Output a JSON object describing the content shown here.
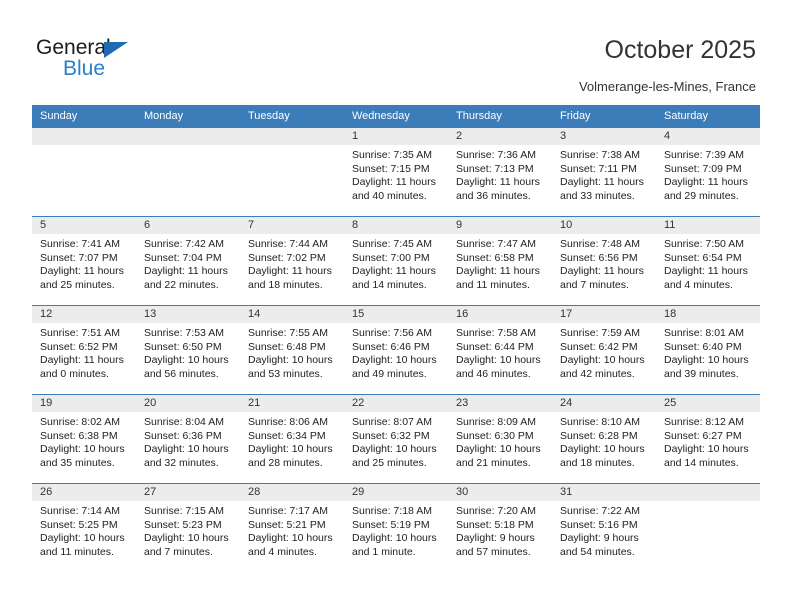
{
  "brand": {
    "word1": "General",
    "word2": "Blue",
    "triangle_color": "#1f6cb4",
    "blue_color": "#2a7fc9"
  },
  "header": {
    "title": "October 2025",
    "location": "Volmerange-les-Mines, France"
  },
  "theme": {
    "header_bg": "#3b7cb9",
    "daynum_bg": "#ececec",
    "text": "#1f1f1f"
  },
  "weekdays": [
    "Sunday",
    "Monday",
    "Tuesday",
    "Wednesday",
    "Thursday",
    "Friday",
    "Saturday"
  ],
  "weeks": [
    [
      {
        "day": "",
        "empty": true
      },
      {
        "day": "",
        "empty": true
      },
      {
        "day": "",
        "empty": true
      },
      {
        "day": "1",
        "sunrise": "Sunrise: 7:35 AM",
        "sunset": "Sunset: 7:15 PM",
        "daylight1": "Daylight: 11 hours",
        "daylight2": "and 40 minutes."
      },
      {
        "day": "2",
        "sunrise": "Sunrise: 7:36 AM",
        "sunset": "Sunset: 7:13 PM",
        "daylight1": "Daylight: 11 hours",
        "daylight2": "and 36 minutes."
      },
      {
        "day": "3",
        "sunrise": "Sunrise: 7:38 AM",
        "sunset": "Sunset: 7:11 PM",
        "daylight1": "Daylight: 11 hours",
        "daylight2": "and 33 minutes."
      },
      {
        "day": "4",
        "sunrise": "Sunrise: 7:39 AM",
        "sunset": "Sunset: 7:09 PM",
        "daylight1": "Daylight: 11 hours",
        "daylight2": "and 29 minutes."
      }
    ],
    [
      {
        "day": "5",
        "sunrise": "Sunrise: 7:41 AM",
        "sunset": "Sunset: 7:07 PM",
        "daylight1": "Daylight: 11 hours",
        "daylight2": "and 25 minutes."
      },
      {
        "day": "6",
        "sunrise": "Sunrise: 7:42 AM",
        "sunset": "Sunset: 7:04 PM",
        "daylight1": "Daylight: 11 hours",
        "daylight2": "and 22 minutes."
      },
      {
        "day": "7",
        "sunrise": "Sunrise: 7:44 AM",
        "sunset": "Sunset: 7:02 PM",
        "daylight1": "Daylight: 11 hours",
        "daylight2": "and 18 minutes."
      },
      {
        "day": "8",
        "sunrise": "Sunrise: 7:45 AM",
        "sunset": "Sunset: 7:00 PM",
        "daylight1": "Daylight: 11 hours",
        "daylight2": "and 14 minutes."
      },
      {
        "day": "9",
        "sunrise": "Sunrise: 7:47 AM",
        "sunset": "Sunset: 6:58 PM",
        "daylight1": "Daylight: 11 hours",
        "daylight2": "and 11 minutes."
      },
      {
        "day": "10",
        "sunrise": "Sunrise: 7:48 AM",
        "sunset": "Sunset: 6:56 PM",
        "daylight1": "Daylight: 11 hours",
        "daylight2": "and 7 minutes."
      },
      {
        "day": "11",
        "sunrise": "Sunrise: 7:50 AM",
        "sunset": "Sunset: 6:54 PM",
        "daylight1": "Daylight: 11 hours",
        "daylight2": "and 4 minutes."
      }
    ],
    [
      {
        "day": "12",
        "sunrise": "Sunrise: 7:51 AM",
        "sunset": "Sunset: 6:52 PM",
        "daylight1": "Daylight: 11 hours",
        "daylight2": "and 0 minutes."
      },
      {
        "day": "13",
        "sunrise": "Sunrise: 7:53 AM",
        "sunset": "Sunset: 6:50 PM",
        "daylight1": "Daylight: 10 hours",
        "daylight2": "and 56 minutes."
      },
      {
        "day": "14",
        "sunrise": "Sunrise: 7:55 AM",
        "sunset": "Sunset: 6:48 PM",
        "daylight1": "Daylight: 10 hours",
        "daylight2": "and 53 minutes."
      },
      {
        "day": "15",
        "sunrise": "Sunrise: 7:56 AM",
        "sunset": "Sunset: 6:46 PM",
        "daylight1": "Daylight: 10 hours",
        "daylight2": "and 49 minutes."
      },
      {
        "day": "16",
        "sunrise": "Sunrise: 7:58 AM",
        "sunset": "Sunset: 6:44 PM",
        "daylight1": "Daylight: 10 hours",
        "daylight2": "and 46 minutes."
      },
      {
        "day": "17",
        "sunrise": "Sunrise: 7:59 AM",
        "sunset": "Sunset: 6:42 PM",
        "daylight1": "Daylight: 10 hours",
        "daylight2": "and 42 minutes."
      },
      {
        "day": "18",
        "sunrise": "Sunrise: 8:01 AM",
        "sunset": "Sunset: 6:40 PM",
        "daylight1": "Daylight: 10 hours",
        "daylight2": "and 39 minutes."
      }
    ],
    [
      {
        "day": "19",
        "sunrise": "Sunrise: 8:02 AM",
        "sunset": "Sunset: 6:38 PM",
        "daylight1": "Daylight: 10 hours",
        "daylight2": "and 35 minutes."
      },
      {
        "day": "20",
        "sunrise": "Sunrise: 8:04 AM",
        "sunset": "Sunset: 6:36 PM",
        "daylight1": "Daylight: 10 hours",
        "daylight2": "and 32 minutes."
      },
      {
        "day": "21",
        "sunrise": "Sunrise: 8:06 AM",
        "sunset": "Sunset: 6:34 PM",
        "daylight1": "Daylight: 10 hours",
        "daylight2": "and 28 minutes."
      },
      {
        "day": "22",
        "sunrise": "Sunrise: 8:07 AM",
        "sunset": "Sunset: 6:32 PM",
        "daylight1": "Daylight: 10 hours",
        "daylight2": "and 25 minutes."
      },
      {
        "day": "23",
        "sunrise": "Sunrise: 8:09 AM",
        "sunset": "Sunset: 6:30 PM",
        "daylight1": "Daylight: 10 hours",
        "daylight2": "and 21 minutes."
      },
      {
        "day": "24",
        "sunrise": "Sunrise: 8:10 AM",
        "sunset": "Sunset: 6:28 PM",
        "daylight1": "Daylight: 10 hours",
        "daylight2": "and 18 minutes."
      },
      {
        "day": "25",
        "sunrise": "Sunrise: 8:12 AM",
        "sunset": "Sunset: 6:27 PM",
        "daylight1": "Daylight: 10 hours",
        "daylight2": "and 14 minutes."
      }
    ],
    [
      {
        "day": "26",
        "sunrise": "Sunrise: 7:14 AM",
        "sunset": "Sunset: 5:25 PM",
        "daylight1": "Daylight: 10 hours",
        "daylight2": "and 11 minutes."
      },
      {
        "day": "27",
        "sunrise": "Sunrise: 7:15 AM",
        "sunset": "Sunset: 5:23 PM",
        "daylight1": "Daylight: 10 hours",
        "daylight2": "and 7 minutes."
      },
      {
        "day": "28",
        "sunrise": "Sunrise: 7:17 AM",
        "sunset": "Sunset: 5:21 PM",
        "daylight1": "Daylight: 10 hours",
        "daylight2": "and 4 minutes."
      },
      {
        "day": "29",
        "sunrise": "Sunrise: 7:18 AM",
        "sunset": "Sunset: 5:19 PM",
        "daylight1": "Daylight: 10 hours",
        "daylight2": "and 1 minute."
      },
      {
        "day": "30",
        "sunrise": "Sunrise: 7:20 AM",
        "sunset": "Sunset: 5:18 PM",
        "daylight1": "Daylight: 9 hours",
        "daylight2": "and 57 minutes."
      },
      {
        "day": "31",
        "sunrise": "Sunrise: 7:22 AM",
        "sunset": "Sunset: 5:16 PM",
        "daylight1": "Daylight: 9 hours",
        "daylight2": "and 54 minutes."
      },
      {
        "day": "",
        "empty": true
      }
    ]
  ]
}
